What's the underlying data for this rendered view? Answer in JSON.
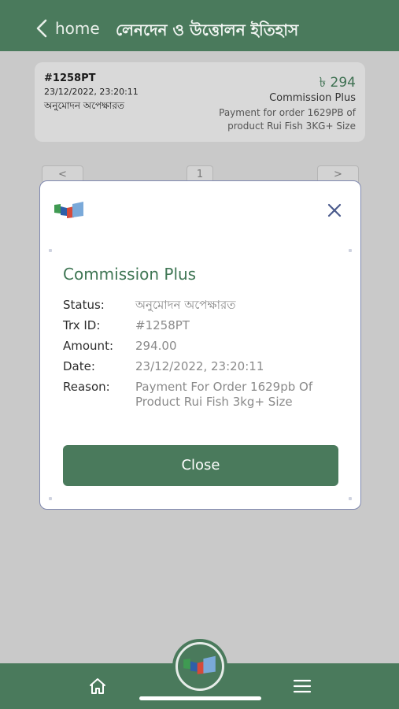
{
  "header": {
    "back_label": "home",
    "title": "লেনদেন ও উত্তোলন ইতিহাস"
  },
  "transaction": {
    "id": "#1258PT",
    "date": "23/12/2022, 23:20:11",
    "status": "অনুমোদন অপেক্ষারত",
    "amount": "৳ 294",
    "type": "Commission Plus",
    "description": "Payment for order 1629PB of product Rui Fish 3KG+ Size"
  },
  "pagination": {
    "prev": "<",
    "page": "1",
    "next": ">"
  },
  "modal": {
    "title": "Commission Plus",
    "rows": [
      {
        "label": "Status:",
        "value": "অনুমোদন অপেক্ষারত"
      },
      {
        "label": "Trx ID:",
        "value": "#1258PT"
      },
      {
        "label": "Amount:",
        "value": "294.00"
      },
      {
        "label": "Date:",
        "value": "23/12/2022, 23:20:11"
      },
      {
        "label": "Reason:",
        "value": "Payment For Order 1629pb Of Product Rui Fish 3kg+ Size"
      }
    ],
    "close_button": "Close"
  },
  "bottom_nav": {
    "home_icon": "home-icon",
    "center_icon": "brand-logo-icon",
    "menu_icon": "menu-icon"
  },
  "colors": {
    "primary": "#4a7a5c",
    "accent_text": "#3f7654",
    "overlay": "#c9c9c9",
    "modal_border": "#8089b0"
  }
}
